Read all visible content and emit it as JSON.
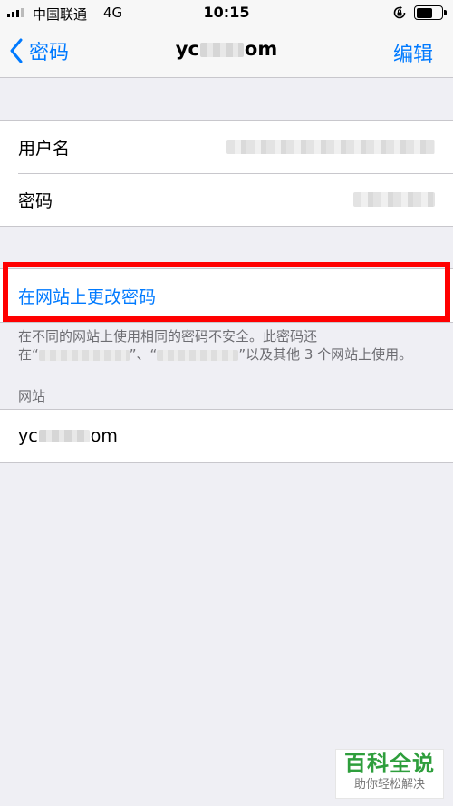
{
  "status_bar": {
    "carrier": "中国联通",
    "network": "4G",
    "time": "10:15"
  },
  "nav": {
    "back_label": "密码",
    "title_start": "yc",
    "title_end": "om",
    "edit_label": "编辑"
  },
  "credentials": {
    "username_label": "用户名",
    "password_label": "密码"
  },
  "change_password_label": "在网站上更改密码",
  "warning": {
    "line1": "在不同的网站上使用相同的密码不安全。此密码还",
    "line2_prefix": "在“",
    "line2_mid": "”、“",
    "line2_suffix": "”以及其他 3 个网站上使用。"
  },
  "websites_header": "网站",
  "website": {
    "start": "yc",
    "end": "om"
  },
  "watermark": {
    "title": "百科全说",
    "subtitle": "助你轻松解决"
  },
  "colors": {
    "accent": "#007aff",
    "highlight": "#ff0000",
    "watermark": "#2e9e3c"
  }
}
